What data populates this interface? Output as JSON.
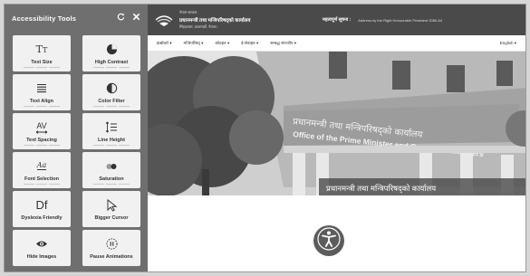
{
  "panel": {
    "title": "Accessibility Tools",
    "reset_icon": "reset-icon",
    "close_icon": "close-icon",
    "tools": [
      {
        "label": "Text Size",
        "glyph": "TT",
        "icon": "text-size-icon",
        "level_bars": 3
      },
      {
        "label": "High Contrast",
        "glyph": "◐",
        "icon": "high-contrast-icon",
        "level_bars": 3
      },
      {
        "label": "Text Align",
        "glyph": "≡",
        "icon": "text-align-icon",
        "level_bars": 3
      },
      {
        "label": "Color Filter",
        "glyph": "◑",
        "icon": "color-filter-icon",
        "level_bars": 3
      },
      {
        "label": "Text Spacing",
        "glyph": "AV",
        "icon": "text-spacing-icon",
        "level_bars": 3
      },
      {
        "label": "Line Height",
        "glyph": "↕≡",
        "icon": "line-height-icon",
        "level_bars": 3
      },
      {
        "label": "Font Selection",
        "glyph": "Aa",
        "icon": "font-selection-icon",
        "level_bars": 3
      },
      {
        "label": "Saturation",
        "glyph": "●●",
        "icon": "saturation-icon",
        "level_bars": 3
      },
      {
        "label": "Dyslexia Friendly",
        "glyph": "Df",
        "icon": "dyslexia-icon",
        "level_bars": 0
      },
      {
        "label": "Bigger Cursor",
        "glyph": "⇖",
        "icon": "cursor-icon",
        "level_bars": 0
      },
      {
        "label": "Hide Images",
        "glyph": "◉",
        "icon": "hide-images-icon",
        "level_bars": 0
      },
      {
        "label": "Pause Animations",
        "glyph": "⏸",
        "icon": "pause-animations-icon",
        "level_bars": 0
      }
    ]
  },
  "site": {
    "header": {
      "small_line": "नेपाल सरकार",
      "office_name": "प्रधानमन्त्री तथा मन्त्रिपरिषद्को कार्यालय",
      "address": "सिंहदरबार, काठमाडौं, नेपाल।",
      "notice_title": "महत्वपूर्ण सूचना :",
      "notice_text": "Address by the Right Honourable President 2080-84"
    },
    "nav": {
      "items": [
        "हाम्रोबारे ▾",
        "मन्त्रिपरिषद् ▾",
        "कोठहरु ▾",
        "ई-सेवाहरु ▾",
        "सम्बद्ध संयन्त्रीय ▾"
      ],
      "language": "English ▾"
    },
    "hero": {
      "caption": "प्रधानमन्त्री तथा मन्त्रिपरिषद्को कार्यालय",
      "building_sign_nepali": "प्रधानमन्त्री तथा मन्त्रिपरिषद्को कार्यालय",
      "building_sign_english": "Office of the Prime Minister and Council of Ministers"
    },
    "accessibility_button_icon": "accessibility-person-icon"
  },
  "colors": {
    "panel_bg": "#6f6f6f",
    "tile_bg": "#f1f1f1",
    "topbar_bg": "#4a4a4a",
    "accessibility_button": "#5c5c5c"
  }
}
